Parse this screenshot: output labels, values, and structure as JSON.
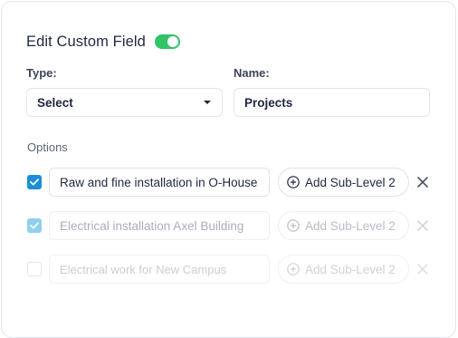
{
  "header": {
    "title": "Edit Custom Field",
    "enabled": true
  },
  "type": {
    "label": "Type:",
    "value": "Select"
  },
  "name": {
    "label": "Name:",
    "value": "Projects"
  },
  "options": {
    "label": "Options",
    "add_sublevel_label": "Add Sub-Level 2",
    "items": [
      {
        "text": "Raw and fine installation in O-House",
        "checked": true
      },
      {
        "text": "Electrical installation Axel Building",
        "checked": true
      },
      {
        "text": "Electrical work for New Campus",
        "checked": false
      }
    ]
  },
  "colors": {
    "accent": "#1b8fd9",
    "toggle_on": "#2ec467",
    "text": "#1f2740"
  },
  "icons": {
    "check": "check-icon",
    "add": "plus-circle-icon",
    "remove": "close-icon",
    "dropdown": "chevron-down-icon"
  }
}
